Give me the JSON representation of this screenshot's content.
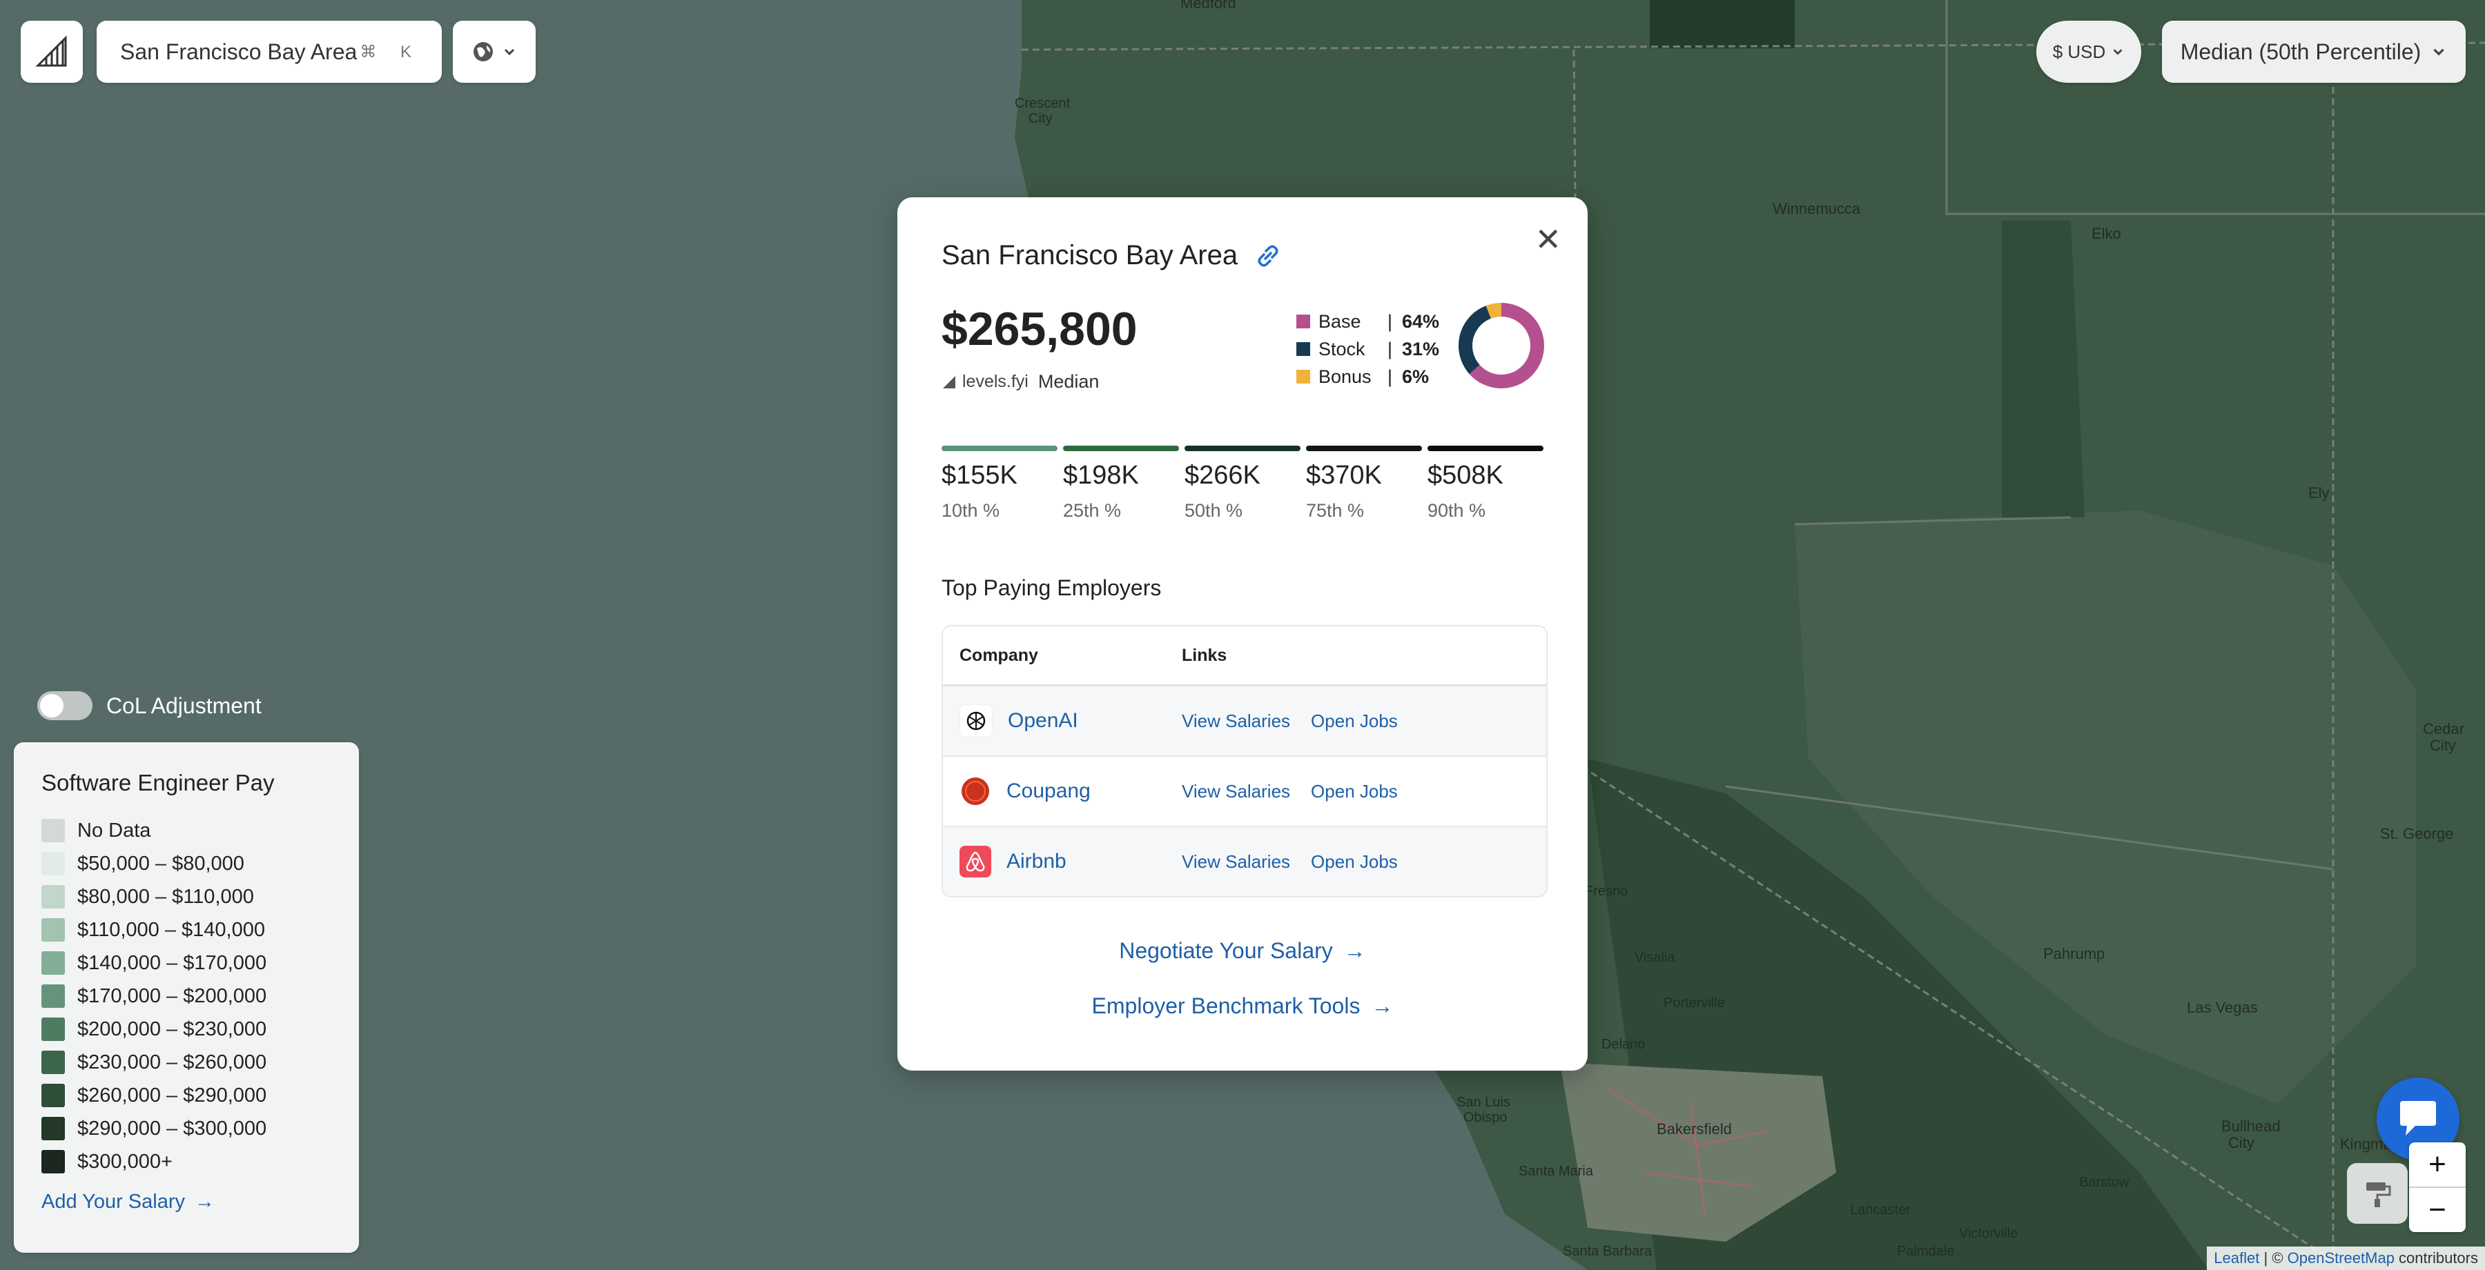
{
  "search": {
    "location": "San Francisco Bay Area",
    "shortcut": "⌘ K"
  },
  "currency": {
    "label": "$ USD"
  },
  "percentile_select": {
    "label": "Median (50th Percentile)"
  },
  "col_toggle": {
    "label": "CoL Adjustment",
    "on": false
  },
  "legend": {
    "title": "Software Engineer Pay",
    "items": [
      {
        "label": "No Data",
        "color": "#d4d8d7"
      },
      {
        "label": "$50,000 – $80,000",
        "color": "#e3ebe7"
      },
      {
        "label": "$80,000 – $110,000",
        "color": "#c3d6cc"
      },
      {
        "label": "$110,000 – $140,000",
        "color": "#a3c3b1"
      },
      {
        "label": "$140,000 – $170,000",
        "color": "#83ad95"
      },
      {
        "label": "$170,000 – $200,000",
        "color": "#64957a"
      },
      {
        "label": "$200,000 – $230,000",
        "color": "#4c7d60"
      },
      {
        "label": "$230,000 – $260,000",
        "color": "#3b6649"
      },
      {
        "label": "$260,000 – $290,000",
        "color": "#2e4e37"
      },
      {
        "label": "$290,000 – $300,000",
        "color": "#233828"
      },
      {
        "label": "$300,000+",
        "color": "#1c251e"
      }
    ],
    "add_salary": "Add Your Salary"
  },
  "modal": {
    "title": "San Francisco Bay Area",
    "amount": "$265,800",
    "source_brand": "levels.fyi",
    "source_label": "Median",
    "breakdown": [
      {
        "name": "Base",
        "pct": "64%",
        "value": 64,
        "color": "#b5508f"
      },
      {
        "name": "Stock",
        "pct": "31%",
        "value": 31,
        "color": "#173a52"
      },
      {
        "name": "Bonus",
        "pct": "6%",
        "value": 6,
        "color": "#f0b23a"
      }
    ],
    "percentiles": [
      {
        "value": "$155K",
        "label": "10th %",
        "color": "#5b9478"
      },
      {
        "value": "$198K",
        "label": "25th %",
        "color": "#2d6a3f"
      },
      {
        "value": "$266K",
        "label": "50th %",
        "color": "#163222"
      },
      {
        "value": "$370K",
        "label": "75th %",
        "color": "#111611"
      },
      {
        "value": "$508K",
        "label": "90th %",
        "color": "#0b0d0b"
      }
    ],
    "top_title": "Top Paying Employers",
    "table": {
      "headers": {
        "company": "Company",
        "links": "Links"
      },
      "rows": [
        {
          "company": "OpenAI",
          "view": "View Salaries",
          "jobs": "Open Jobs"
        },
        {
          "company": "Coupang",
          "view": "View Salaries",
          "jobs": "Open Jobs"
        },
        {
          "company": "Airbnb",
          "view": "View Salaries",
          "jobs": "Open Jobs"
        }
      ]
    },
    "cta_negotiate": "Negotiate Your Salary",
    "cta_benchmark": "Employer Benchmark Tools",
    "arrow": "→"
  },
  "map_labels": {
    "medford": "Medford",
    "crescent_city": "Crescent\nCity",
    "winnemucca": "Winnemucca",
    "elko": "Elko",
    "ely": "Ely",
    "cedar_city": "Cedar\nCity",
    "st_george": "St. George",
    "las_vegas": "Las Vegas",
    "pahrump": "Pahrump",
    "bullhead_city": "Bullhead\nCity",
    "kingman": "Kingman",
    "bakersfield": "Bakersfield",
    "san_luis_obispo": "San Luis\nObispo",
    "santa_maria": "Santa Maria",
    "santa_barbara": "Santa Barbara",
    "palmdale": "Palmdale",
    "lancaster": "Lancaster",
    "barstow": "Barstow",
    "victorville": "Victorville",
    "visalia": "Visalia",
    "porterville": "Porterville",
    "delano": "Delano",
    "fresno": "Fresno"
  },
  "attribution": {
    "leaflet": "Leaflet",
    "sep": " | © ",
    "osm": "OpenStreetMap",
    "contrib": " contributors"
  }
}
